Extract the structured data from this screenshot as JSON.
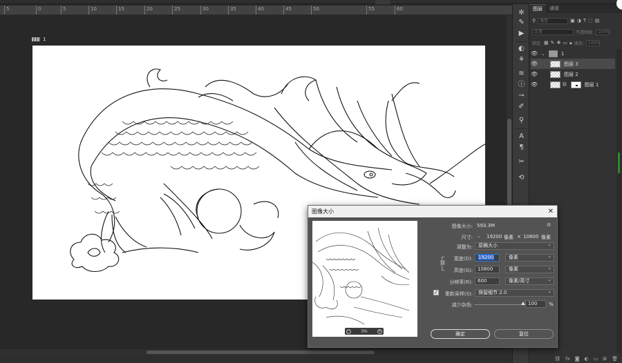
{
  "ruler": {
    "ticks": [
      "5",
      "0",
      "5",
      "10",
      "15",
      "20",
      "25",
      "30",
      "35",
      "40",
      "45",
      "50",
      "55",
      "60"
    ]
  },
  "document": {
    "label": "1"
  },
  "panel": {
    "tabs": [
      "图层",
      "通道"
    ],
    "filter_placeholder": "类型",
    "blend_mode": "正常",
    "opacity_label": "不透明度:",
    "opacity_value": "100%",
    "lock_label": "锁定:",
    "fill_label": "填充:",
    "fill_value": "100%",
    "layers": [
      {
        "name": "1",
        "type": "group"
      },
      {
        "name": "图层 3",
        "selected": true
      },
      {
        "name": "图层 2"
      },
      {
        "name": "图层 1",
        "has_mask": true
      }
    ]
  },
  "dialog": {
    "title": "图像大小",
    "image_size_label": "图像大小:",
    "image_size_value": "593.3M",
    "dimensions_label": "尺寸:",
    "dim_width": "19200",
    "dim_unit": "像素",
    "dim_sep": "×",
    "dim_height": "10800",
    "fit_to_label": "调整为:",
    "fit_to_value": "原稿大小",
    "width_label": "宽度(D):",
    "width_value": "19200",
    "width_unit": "像素",
    "height_label": "高度(G):",
    "height_value": "10800",
    "height_unit": "像素",
    "resolution_label": "分辨率(R):",
    "resolution_value": "600",
    "resolution_unit": "像素/英寸",
    "resample_checked": true,
    "resample_label": "重新采样(S):",
    "resample_value": "保留细节 2.0",
    "noise_label": "减少杂色:",
    "noise_value": "100",
    "noise_pct": "%",
    "noise_level": 1.0,
    "preview_zoom": "3%",
    "ok_label": "确定",
    "reset_label": "复位"
  },
  "colors": {
    "selection_highlight": "#2f63c8",
    "panel_bg": "#323232",
    "dialog_bg": "#535353"
  }
}
